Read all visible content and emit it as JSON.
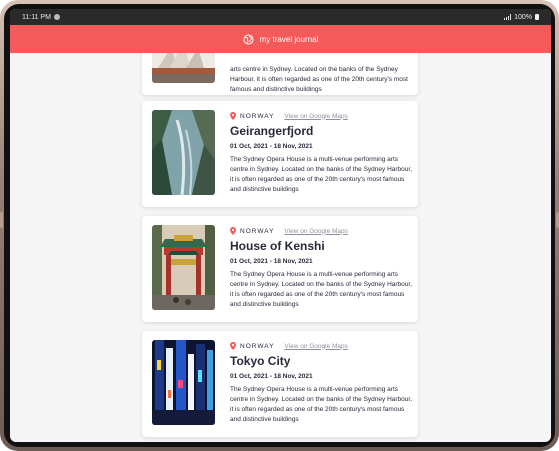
{
  "status_bar": {
    "time": "11:11 PM",
    "battery": "100%"
  },
  "app": {
    "title": "my travel journal",
    "icon": "globe-icon",
    "accent_color": "#F55A5A"
  },
  "entries": [
    {
      "country": "",
      "maps_label": "",
      "title": "",
      "dates": "",
      "description": "arts centre in Sydney. Located on the banks of the Sydney Harbour, it is often regarded as one of the 20th century's most famous and distinctive buildings"
    },
    {
      "country": "NORWAY",
      "maps_label": "View on Google Maps",
      "title": "Geirangerfjord",
      "dates": "01 Oct, 2021 - 18 Nov, 2021",
      "description": "The Sydney Opera House is a multi-venue performing arts centre in Sydney. Located on the banks of the Sydney Harbour, it is often regarded as one of the 20th century's most famous and distinctive buildings"
    },
    {
      "country": "NORWAY",
      "maps_label": "View on Google Maps",
      "title": "House of Kenshi",
      "dates": "01 Oct, 2021 - 18 Nov, 2021",
      "description": "The Sydney Opera House is a multi-venue performing arts centre in Sydney. Located on the banks of the Sydney Harbour, it is often regarded as one of the 20th century's most famous and distinctive buildings"
    },
    {
      "country": "NORWAY",
      "maps_label": "View on Google Maps",
      "title": "Tokyo City",
      "dates": "01 Oct, 2021 - 18 Nov, 2021",
      "description": "The Sydney Opera House is a multi-venue performing arts centre in Sydney. Located on the banks of the Sydney Harbour, it is often regarded as one of the 20th century's most famous and distinctive buildings"
    }
  ]
}
